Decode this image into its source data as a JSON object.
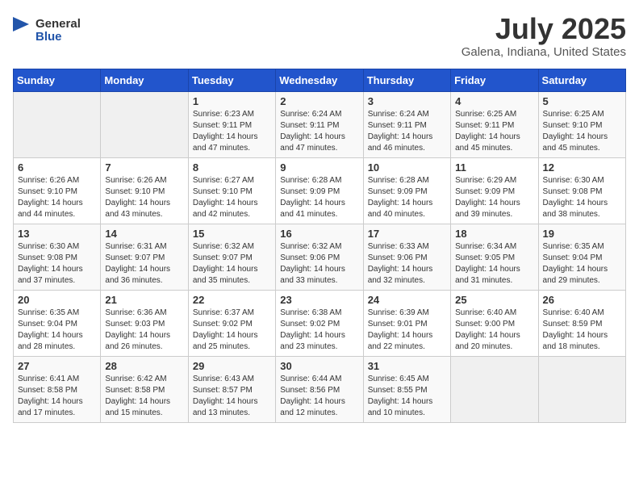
{
  "header": {
    "logo_general": "General",
    "logo_blue": "Blue",
    "month": "July 2025",
    "location": "Galena, Indiana, United States"
  },
  "days_of_week": [
    "Sunday",
    "Monday",
    "Tuesday",
    "Wednesday",
    "Thursday",
    "Friday",
    "Saturday"
  ],
  "weeks": [
    [
      {
        "day": "",
        "empty": true
      },
      {
        "day": "",
        "empty": true
      },
      {
        "day": "1",
        "sunrise": "Sunrise: 6:23 AM",
        "sunset": "Sunset: 9:11 PM",
        "daylight": "Daylight: 14 hours and 47 minutes."
      },
      {
        "day": "2",
        "sunrise": "Sunrise: 6:24 AM",
        "sunset": "Sunset: 9:11 PM",
        "daylight": "Daylight: 14 hours and 47 minutes."
      },
      {
        "day": "3",
        "sunrise": "Sunrise: 6:24 AM",
        "sunset": "Sunset: 9:11 PM",
        "daylight": "Daylight: 14 hours and 46 minutes."
      },
      {
        "day": "4",
        "sunrise": "Sunrise: 6:25 AM",
        "sunset": "Sunset: 9:11 PM",
        "daylight": "Daylight: 14 hours and 45 minutes."
      },
      {
        "day": "5",
        "sunrise": "Sunrise: 6:25 AM",
        "sunset": "Sunset: 9:10 PM",
        "daylight": "Daylight: 14 hours and 45 minutes."
      }
    ],
    [
      {
        "day": "6",
        "sunrise": "Sunrise: 6:26 AM",
        "sunset": "Sunset: 9:10 PM",
        "daylight": "Daylight: 14 hours and 44 minutes."
      },
      {
        "day": "7",
        "sunrise": "Sunrise: 6:26 AM",
        "sunset": "Sunset: 9:10 PM",
        "daylight": "Daylight: 14 hours and 43 minutes."
      },
      {
        "day": "8",
        "sunrise": "Sunrise: 6:27 AM",
        "sunset": "Sunset: 9:10 PM",
        "daylight": "Daylight: 14 hours and 42 minutes."
      },
      {
        "day": "9",
        "sunrise": "Sunrise: 6:28 AM",
        "sunset": "Sunset: 9:09 PM",
        "daylight": "Daylight: 14 hours and 41 minutes."
      },
      {
        "day": "10",
        "sunrise": "Sunrise: 6:28 AM",
        "sunset": "Sunset: 9:09 PM",
        "daylight": "Daylight: 14 hours and 40 minutes."
      },
      {
        "day": "11",
        "sunrise": "Sunrise: 6:29 AM",
        "sunset": "Sunset: 9:09 PM",
        "daylight": "Daylight: 14 hours and 39 minutes."
      },
      {
        "day": "12",
        "sunrise": "Sunrise: 6:30 AM",
        "sunset": "Sunset: 9:08 PM",
        "daylight": "Daylight: 14 hours and 38 minutes."
      }
    ],
    [
      {
        "day": "13",
        "sunrise": "Sunrise: 6:30 AM",
        "sunset": "Sunset: 9:08 PM",
        "daylight": "Daylight: 14 hours and 37 minutes."
      },
      {
        "day": "14",
        "sunrise": "Sunrise: 6:31 AM",
        "sunset": "Sunset: 9:07 PM",
        "daylight": "Daylight: 14 hours and 36 minutes."
      },
      {
        "day": "15",
        "sunrise": "Sunrise: 6:32 AM",
        "sunset": "Sunset: 9:07 PM",
        "daylight": "Daylight: 14 hours and 35 minutes."
      },
      {
        "day": "16",
        "sunrise": "Sunrise: 6:32 AM",
        "sunset": "Sunset: 9:06 PM",
        "daylight": "Daylight: 14 hours and 33 minutes."
      },
      {
        "day": "17",
        "sunrise": "Sunrise: 6:33 AM",
        "sunset": "Sunset: 9:06 PM",
        "daylight": "Daylight: 14 hours and 32 minutes."
      },
      {
        "day": "18",
        "sunrise": "Sunrise: 6:34 AM",
        "sunset": "Sunset: 9:05 PM",
        "daylight": "Daylight: 14 hours and 31 minutes."
      },
      {
        "day": "19",
        "sunrise": "Sunrise: 6:35 AM",
        "sunset": "Sunset: 9:04 PM",
        "daylight": "Daylight: 14 hours and 29 minutes."
      }
    ],
    [
      {
        "day": "20",
        "sunrise": "Sunrise: 6:35 AM",
        "sunset": "Sunset: 9:04 PM",
        "daylight": "Daylight: 14 hours and 28 minutes."
      },
      {
        "day": "21",
        "sunrise": "Sunrise: 6:36 AM",
        "sunset": "Sunset: 9:03 PM",
        "daylight": "Daylight: 14 hours and 26 minutes."
      },
      {
        "day": "22",
        "sunrise": "Sunrise: 6:37 AM",
        "sunset": "Sunset: 9:02 PM",
        "daylight": "Daylight: 14 hours and 25 minutes."
      },
      {
        "day": "23",
        "sunrise": "Sunrise: 6:38 AM",
        "sunset": "Sunset: 9:02 PM",
        "daylight": "Daylight: 14 hours and 23 minutes."
      },
      {
        "day": "24",
        "sunrise": "Sunrise: 6:39 AM",
        "sunset": "Sunset: 9:01 PM",
        "daylight": "Daylight: 14 hours and 22 minutes."
      },
      {
        "day": "25",
        "sunrise": "Sunrise: 6:40 AM",
        "sunset": "Sunset: 9:00 PM",
        "daylight": "Daylight: 14 hours and 20 minutes."
      },
      {
        "day": "26",
        "sunrise": "Sunrise: 6:40 AM",
        "sunset": "Sunset: 8:59 PM",
        "daylight": "Daylight: 14 hours and 18 minutes."
      }
    ],
    [
      {
        "day": "27",
        "sunrise": "Sunrise: 6:41 AM",
        "sunset": "Sunset: 8:58 PM",
        "daylight": "Daylight: 14 hours and 17 minutes."
      },
      {
        "day": "28",
        "sunrise": "Sunrise: 6:42 AM",
        "sunset": "Sunset: 8:58 PM",
        "daylight": "Daylight: 14 hours and 15 minutes."
      },
      {
        "day": "29",
        "sunrise": "Sunrise: 6:43 AM",
        "sunset": "Sunset: 8:57 PM",
        "daylight": "Daylight: 14 hours and 13 minutes."
      },
      {
        "day": "30",
        "sunrise": "Sunrise: 6:44 AM",
        "sunset": "Sunset: 8:56 PM",
        "daylight": "Daylight: 14 hours and 12 minutes."
      },
      {
        "day": "31",
        "sunrise": "Sunrise: 6:45 AM",
        "sunset": "Sunset: 8:55 PM",
        "daylight": "Daylight: 14 hours and 10 minutes."
      },
      {
        "day": "",
        "empty": true
      },
      {
        "day": "",
        "empty": true
      }
    ]
  ]
}
